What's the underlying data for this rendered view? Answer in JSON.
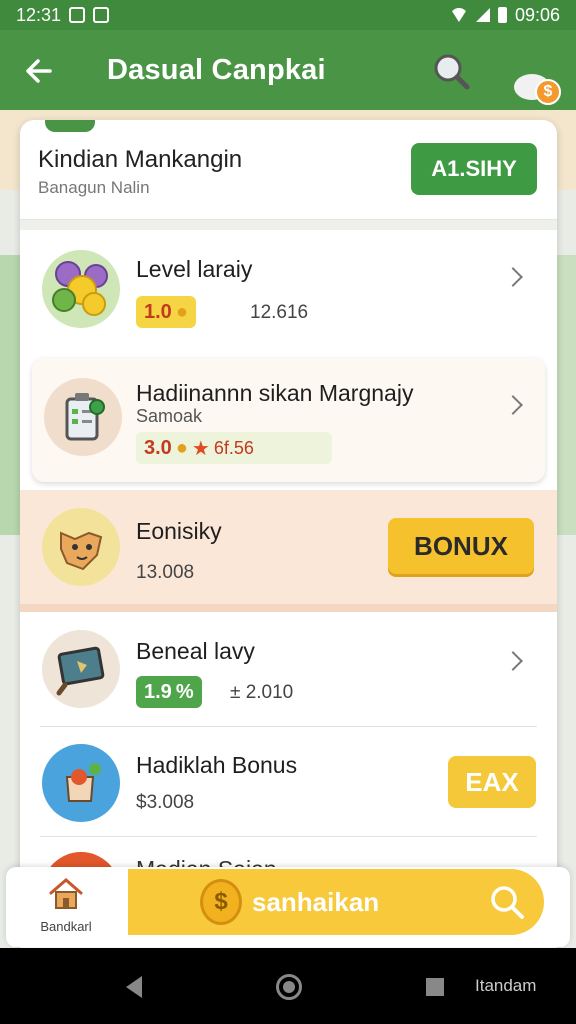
{
  "status": {
    "time": "12:31",
    "clock_right": "09:06"
  },
  "appbar": {
    "title": "Dasual Canpkai"
  },
  "notif": {
    "badge": "$"
  },
  "header": {
    "title": "Kindian Mankangin",
    "subtitle": "Banagun Nalin",
    "button": "A1.SIHY"
  },
  "rows": [
    {
      "title": "Level laraiy",
      "pill": "1.0",
      "value": "12.616"
    },
    {
      "title": "Hadiinannn sikan Margnajy",
      "subtitle": "Samoak",
      "pill": "3.0",
      "value": "6f.56"
    },
    {
      "title": "Eonisiky",
      "value": "13.008",
      "button": "BONUX"
    },
    {
      "title": "Beneal lavy",
      "pill": "1.9",
      "value": "± 2.010"
    },
    {
      "title": "Hadiklah Bonus",
      "value": "$3.008",
      "button": "EAX"
    },
    {
      "title": "Madian Sajan"
    }
  ],
  "bottom_nav": {
    "home_label": "Bandkarl",
    "promo_label": "sanhaikan"
  },
  "system_nav": {
    "label": "Itandam"
  },
  "colors": {
    "primary_green": "#4a9445",
    "accent_yellow": "#f5c12c",
    "highlight_peach": "#fbe7d8"
  },
  "icons": [
    "back-arrow-icon",
    "search-icon",
    "chat-bubble-icon",
    "home-icon",
    "coin-icon",
    "chevron-right-icon"
  ]
}
